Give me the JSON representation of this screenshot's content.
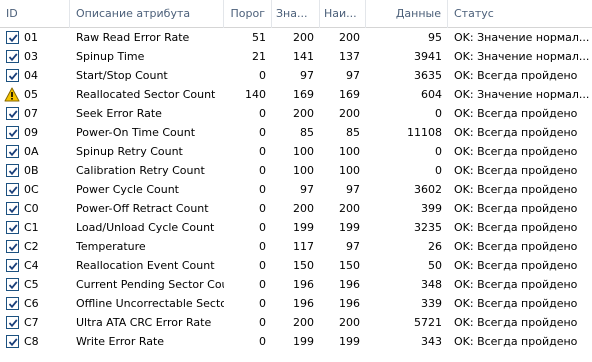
{
  "columns": {
    "id": "ID",
    "name": "Описание атрибута",
    "threshold": "Порог",
    "value": "Зна...",
    "worst": "Наи...",
    "data": "Данные",
    "status": "Статус"
  },
  "rows": [
    {
      "icon": "checkbox",
      "id": "01",
      "name": "Raw Read Error Rate",
      "threshold": "51",
      "value": "200",
      "worst": "200",
      "data": "95",
      "status": "OK: Значение нормал..."
    },
    {
      "icon": "checkbox",
      "id": "03",
      "name": "Spinup Time",
      "threshold": "21",
      "value": "141",
      "worst": "137",
      "data": "3941",
      "status": "OK: Значение нормал..."
    },
    {
      "icon": "checkbox",
      "id": "04",
      "name": "Start/Stop Count",
      "threshold": "0",
      "value": "97",
      "worst": "97",
      "data": "3635",
      "status": "OK: Всегда пройдено"
    },
    {
      "icon": "warning",
      "id": "05",
      "name": "Reallocated Sector Count",
      "threshold": "140",
      "value": "169",
      "worst": "169",
      "data": "604",
      "status": "OK: Значение нормал..."
    },
    {
      "icon": "checkbox",
      "id": "07",
      "name": "Seek Error Rate",
      "threshold": "0",
      "value": "200",
      "worst": "200",
      "data": "0",
      "status": "OK: Всегда пройдено"
    },
    {
      "icon": "checkbox",
      "id": "09",
      "name": "Power-On Time Count",
      "threshold": "0",
      "value": "85",
      "worst": "85",
      "data": "11108",
      "status": "OK: Всегда пройдено"
    },
    {
      "icon": "checkbox",
      "id": "0A",
      "name": "Spinup Retry Count",
      "threshold": "0",
      "value": "100",
      "worst": "100",
      "data": "0",
      "status": "OK: Всегда пройдено"
    },
    {
      "icon": "checkbox",
      "id": "0B",
      "name": "Calibration Retry Count",
      "threshold": "0",
      "value": "100",
      "worst": "100",
      "data": "0",
      "status": "OK: Всегда пройдено"
    },
    {
      "icon": "checkbox",
      "id": "0C",
      "name": "Power Cycle Count",
      "threshold": "0",
      "value": "97",
      "worst": "97",
      "data": "3602",
      "status": "OK: Всегда пройдено"
    },
    {
      "icon": "checkbox",
      "id": "C0",
      "name": "Power-Off Retract Count",
      "threshold": "0",
      "value": "200",
      "worst": "200",
      "data": "399",
      "status": "OK: Всегда пройдено"
    },
    {
      "icon": "checkbox",
      "id": "C1",
      "name": "Load/Unload Cycle Count",
      "threshold": "0",
      "value": "199",
      "worst": "199",
      "data": "3235",
      "status": "OK: Всегда пройдено"
    },
    {
      "icon": "checkbox",
      "id": "C2",
      "name": "Temperature",
      "threshold": "0",
      "value": "117",
      "worst": "97",
      "data": "26",
      "status": "OK: Всегда пройдено"
    },
    {
      "icon": "checkbox",
      "id": "C4",
      "name": "Reallocation Event Count",
      "threshold": "0",
      "value": "150",
      "worst": "150",
      "data": "50",
      "status": "OK: Всегда пройдено"
    },
    {
      "icon": "checkbox",
      "id": "C5",
      "name": "Current Pending Sector Count",
      "threshold": "0",
      "value": "196",
      "worst": "196",
      "data": "348",
      "status": "OK: Всегда пройдено"
    },
    {
      "icon": "checkbox",
      "id": "C6",
      "name": "Offline Uncorrectable Sector C...",
      "threshold": "0",
      "value": "196",
      "worst": "196",
      "data": "339",
      "status": "OK: Всегда пройдено"
    },
    {
      "icon": "checkbox",
      "id": "C7",
      "name": "Ultra ATA CRC Error Rate",
      "threshold": "0",
      "value": "200",
      "worst": "200",
      "data": "5721",
      "status": "OK: Всегда пройдено"
    },
    {
      "icon": "checkbox",
      "id": "C8",
      "name": "Write Error Rate",
      "threshold": "0",
      "value": "199",
      "worst": "199",
      "data": "343",
      "status": "OK: Всегда пройдено"
    }
  ]
}
